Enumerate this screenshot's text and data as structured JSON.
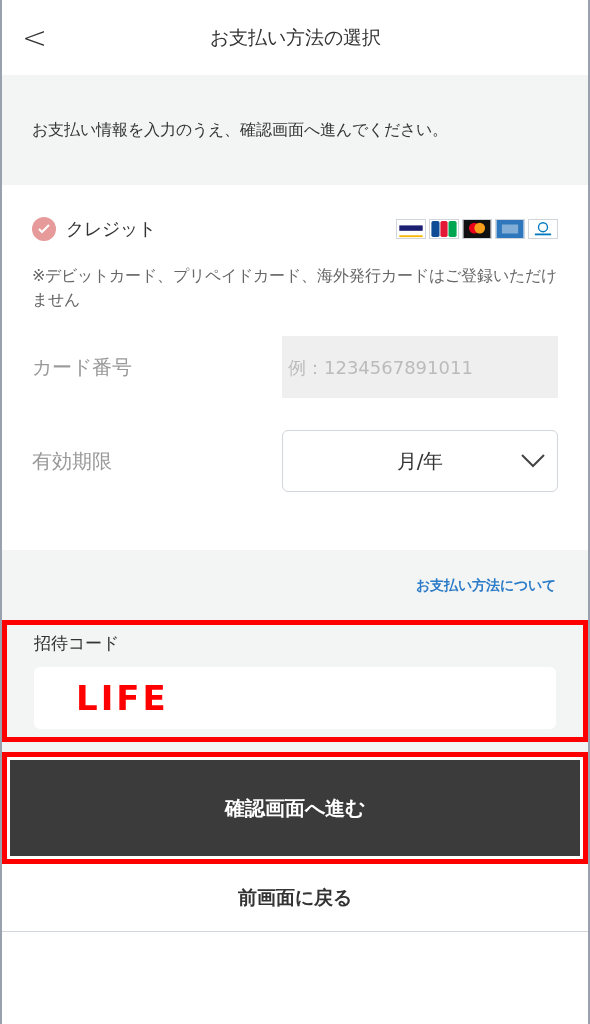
{
  "header": {
    "back": "<",
    "title": "お支払い方法の選択"
  },
  "notice": "お支払い情報を入力のうえ、確認画面へ進んでください。",
  "payment_method": {
    "label": "クレジット",
    "selected": true
  },
  "note": "※デビットカード、プリペイドカード、海外発行カードはご登録いただけません",
  "fields": [
    {
      "kind": "text",
      "label": "カード番号",
      "placeholder": "例：1234567891011"
    },
    {
      "kind": "select",
      "label": "有効期限",
      "value": "月/年"
    }
  ],
  "about_link": "お支払い方法について",
  "invite": {
    "label": "招待コード",
    "value": "LIFE",
    "highlighted": true
  },
  "confirm_button": {
    "label": "確認画面へ進む",
    "highlighted": true
  },
  "back_link": "前画面に戻る"
}
